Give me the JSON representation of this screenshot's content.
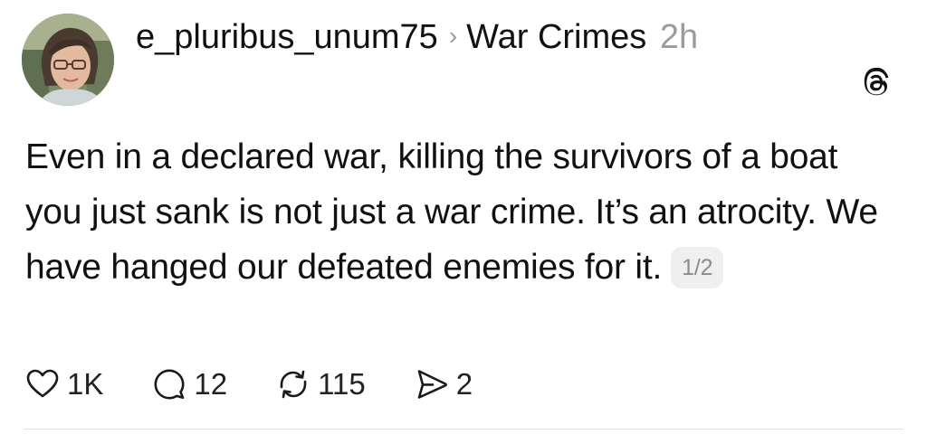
{
  "post": {
    "username": "e_pluribus_unum75",
    "chevron": "›",
    "topic": "War Crimes",
    "time": "2h",
    "text": "Even in a declared war, killing the survivors of a boat you just sank is not just a war crime.  It’s an atrocity.  We have hanged our defeated enemies for it.",
    "page_indicator": "1/2"
  },
  "actions": {
    "likes": "1K",
    "replies": "12",
    "reposts": "115",
    "shares": "2"
  },
  "icons": {
    "app_logo": "threads-logo-icon",
    "like": "heart-icon",
    "reply": "comment-bubble-icon",
    "repost": "repost-arrows-icon",
    "share": "send-icon"
  }
}
